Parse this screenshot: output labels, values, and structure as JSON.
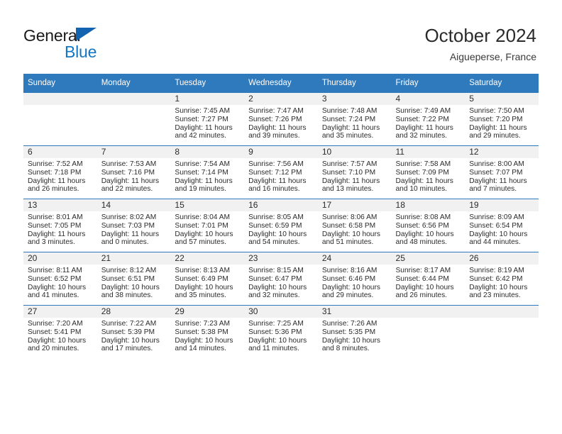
{
  "brand": {
    "name_top": "General",
    "name_bottom": "Blue",
    "triangle_color": "#1263b0",
    "blue_color": "#1276c4"
  },
  "header": {
    "title": "October 2024",
    "location": "Aigueperse, France"
  },
  "theme": {
    "header_blue": "#2f79bd",
    "daynum_band": "#f1f1f1",
    "text": "#2b2b2b"
  },
  "weekday_headers": [
    "Sunday",
    "Monday",
    "Tuesday",
    "Wednesday",
    "Thursday",
    "Friday",
    "Saturday"
  ],
  "labels": {
    "sunrise_prefix": "Sunrise:",
    "sunset_prefix": "Sunset:",
    "daylight_prefix": "Daylight:"
  },
  "weeks": [
    [
      {
        "day": "",
        "lines": []
      },
      {
        "day": "",
        "lines": []
      },
      {
        "day": "1",
        "lines": [
          "Sunrise: 7:45 AM",
          "Sunset: 7:27 PM",
          "Daylight: 11 hours",
          "and 42 minutes."
        ]
      },
      {
        "day": "2",
        "lines": [
          "Sunrise: 7:47 AM",
          "Sunset: 7:26 PM",
          "Daylight: 11 hours",
          "and 39 minutes."
        ]
      },
      {
        "day": "3",
        "lines": [
          "Sunrise: 7:48 AM",
          "Sunset: 7:24 PM",
          "Daylight: 11 hours",
          "and 35 minutes."
        ]
      },
      {
        "day": "4",
        "lines": [
          "Sunrise: 7:49 AM",
          "Sunset: 7:22 PM",
          "Daylight: 11 hours",
          "and 32 minutes."
        ]
      },
      {
        "day": "5",
        "lines": [
          "Sunrise: 7:50 AM",
          "Sunset: 7:20 PM",
          "Daylight: 11 hours",
          "and 29 minutes."
        ]
      }
    ],
    [
      {
        "day": "6",
        "lines": [
          "Sunrise: 7:52 AM",
          "Sunset: 7:18 PM",
          "Daylight: 11 hours",
          "and 26 minutes."
        ]
      },
      {
        "day": "7",
        "lines": [
          "Sunrise: 7:53 AM",
          "Sunset: 7:16 PM",
          "Daylight: 11 hours",
          "and 22 minutes."
        ]
      },
      {
        "day": "8",
        "lines": [
          "Sunrise: 7:54 AM",
          "Sunset: 7:14 PM",
          "Daylight: 11 hours",
          "and 19 minutes."
        ]
      },
      {
        "day": "9",
        "lines": [
          "Sunrise: 7:56 AM",
          "Sunset: 7:12 PM",
          "Daylight: 11 hours",
          "and 16 minutes."
        ]
      },
      {
        "day": "10",
        "lines": [
          "Sunrise: 7:57 AM",
          "Sunset: 7:10 PM",
          "Daylight: 11 hours",
          "and 13 minutes."
        ]
      },
      {
        "day": "11",
        "lines": [
          "Sunrise: 7:58 AM",
          "Sunset: 7:09 PM",
          "Daylight: 11 hours",
          "and 10 minutes."
        ]
      },
      {
        "day": "12",
        "lines": [
          "Sunrise: 8:00 AM",
          "Sunset: 7:07 PM",
          "Daylight: 11 hours",
          "and 7 minutes."
        ]
      }
    ],
    [
      {
        "day": "13",
        "lines": [
          "Sunrise: 8:01 AM",
          "Sunset: 7:05 PM",
          "Daylight: 11 hours",
          "and 3 minutes."
        ]
      },
      {
        "day": "14",
        "lines": [
          "Sunrise: 8:02 AM",
          "Sunset: 7:03 PM",
          "Daylight: 11 hours",
          "and 0 minutes."
        ]
      },
      {
        "day": "15",
        "lines": [
          "Sunrise: 8:04 AM",
          "Sunset: 7:01 PM",
          "Daylight: 10 hours",
          "and 57 minutes."
        ]
      },
      {
        "day": "16",
        "lines": [
          "Sunrise: 8:05 AM",
          "Sunset: 6:59 PM",
          "Daylight: 10 hours",
          "and 54 minutes."
        ]
      },
      {
        "day": "17",
        "lines": [
          "Sunrise: 8:06 AM",
          "Sunset: 6:58 PM",
          "Daylight: 10 hours",
          "and 51 minutes."
        ]
      },
      {
        "day": "18",
        "lines": [
          "Sunrise: 8:08 AM",
          "Sunset: 6:56 PM",
          "Daylight: 10 hours",
          "and 48 minutes."
        ]
      },
      {
        "day": "19",
        "lines": [
          "Sunrise: 8:09 AM",
          "Sunset: 6:54 PM",
          "Daylight: 10 hours",
          "and 44 minutes."
        ]
      }
    ],
    [
      {
        "day": "20",
        "lines": [
          "Sunrise: 8:11 AM",
          "Sunset: 6:52 PM",
          "Daylight: 10 hours",
          "and 41 minutes."
        ]
      },
      {
        "day": "21",
        "lines": [
          "Sunrise: 8:12 AM",
          "Sunset: 6:51 PM",
          "Daylight: 10 hours",
          "and 38 minutes."
        ]
      },
      {
        "day": "22",
        "lines": [
          "Sunrise: 8:13 AM",
          "Sunset: 6:49 PM",
          "Daylight: 10 hours",
          "and 35 minutes."
        ]
      },
      {
        "day": "23",
        "lines": [
          "Sunrise: 8:15 AM",
          "Sunset: 6:47 PM",
          "Daylight: 10 hours",
          "and 32 minutes."
        ]
      },
      {
        "day": "24",
        "lines": [
          "Sunrise: 8:16 AM",
          "Sunset: 6:46 PM",
          "Daylight: 10 hours",
          "and 29 minutes."
        ]
      },
      {
        "day": "25",
        "lines": [
          "Sunrise: 8:17 AM",
          "Sunset: 6:44 PM",
          "Daylight: 10 hours",
          "and 26 minutes."
        ]
      },
      {
        "day": "26",
        "lines": [
          "Sunrise: 8:19 AM",
          "Sunset: 6:42 PM",
          "Daylight: 10 hours",
          "and 23 minutes."
        ]
      }
    ],
    [
      {
        "day": "27",
        "lines": [
          "Sunrise: 7:20 AM",
          "Sunset: 5:41 PM",
          "Daylight: 10 hours",
          "and 20 minutes."
        ]
      },
      {
        "day": "28",
        "lines": [
          "Sunrise: 7:22 AM",
          "Sunset: 5:39 PM",
          "Daylight: 10 hours",
          "and 17 minutes."
        ]
      },
      {
        "day": "29",
        "lines": [
          "Sunrise: 7:23 AM",
          "Sunset: 5:38 PM",
          "Daylight: 10 hours",
          "and 14 minutes."
        ]
      },
      {
        "day": "30",
        "lines": [
          "Sunrise: 7:25 AM",
          "Sunset: 5:36 PM",
          "Daylight: 10 hours",
          "and 11 minutes."
        ]
      },
      {
        "day": "31",
        "lines": [
          "Sunrise: 7:26 AM",
          "Sunset: 5:35 PM",
          "Daylight: 10 hours",
          "and 8 minutes."
        ]
      },
      {
        "day": "",
        "lines": []
      },
      {
        "day": "",
        "lines": []
      }
    ]
  ]
}
